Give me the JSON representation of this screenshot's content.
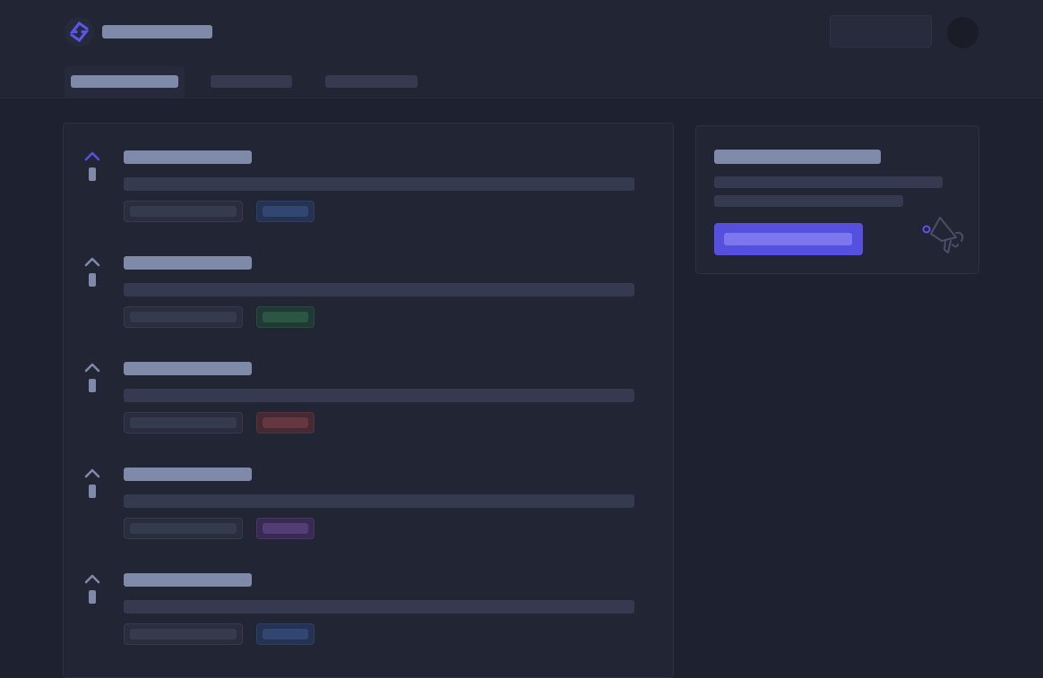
{
  "app": {
    "logo_icon": "logo-icon",
    "accent_color": "#5650e0",
    "title": "",
    "header_button_label": "",
    "avatar_icon": "avatar"
  },
  "tabs": [
    {
      "label": "",
      "active": true
    },
    {
      "label": "",
      "active": false
    },
    {
      "label": "",
      "active": false
    }
  ],
  "feature_list": {
    "items": [
      {
        "vote_icon": "chevron-up-icon",
        "vote_count": "",
        "title": "",
        "description": "",
        "meta": "",
        "status": "",
        "status_color": "blue",
        "upvoted": true
      },
      {
        "vote_icon": "chevron-up-icon",
        "vote_count": "",
        "title": "",
        "description": "",
        "meta": "",
        "status": "",
        "status_color": "green",
        "upvoted": false
      },
      {
        "vote_icon": "chevron-up-icon",
        "vote_count": "",
        "title": "",
        "description": "",
        "meta": "",
        "status": "",
        "status_color": "red",
        "upvoted": false
      },
      {
        "vote_icon": "chevron-up-icon",
        "vote_count": "",
        "title": "",
        "description": "",
        "meta": "",
        "status": "",
        "status_color": "purple",
        "upvoted": false
      },
      {
        "vote_icon": "chevron-up-icon",
        "vote_count": "",
        "title": "",
        "description": "",
        "meta": "",
        "status": "",
        "status_color": "blue",
        "upvoted": false
      }
    ]
  },
  "sidebar_card": {
    "title": "",
    "description_line_1": "",
    "description_line_2": "",
    "cta_label": "",
    "illustration_icon": "megaphone-icon"
  },
  "status_colors": {
    "blue": {
      "bg": "#243352",
      "border": "#2d3f66",
      "fill": "#314771"
    },
    "green": {
      "bg": "#1f3a33",
      "border": "#264a3e",
      "fill": "#2b5545"
    },
    "red": {
      "bg": "#432a33",
      "border": "#583039",
      "fill": "#663743"
    },
    "purple": {
      "bg": "#392a54",
      "border": "#4a3569",
      "fill": "#533d75"
    }
  }
}
